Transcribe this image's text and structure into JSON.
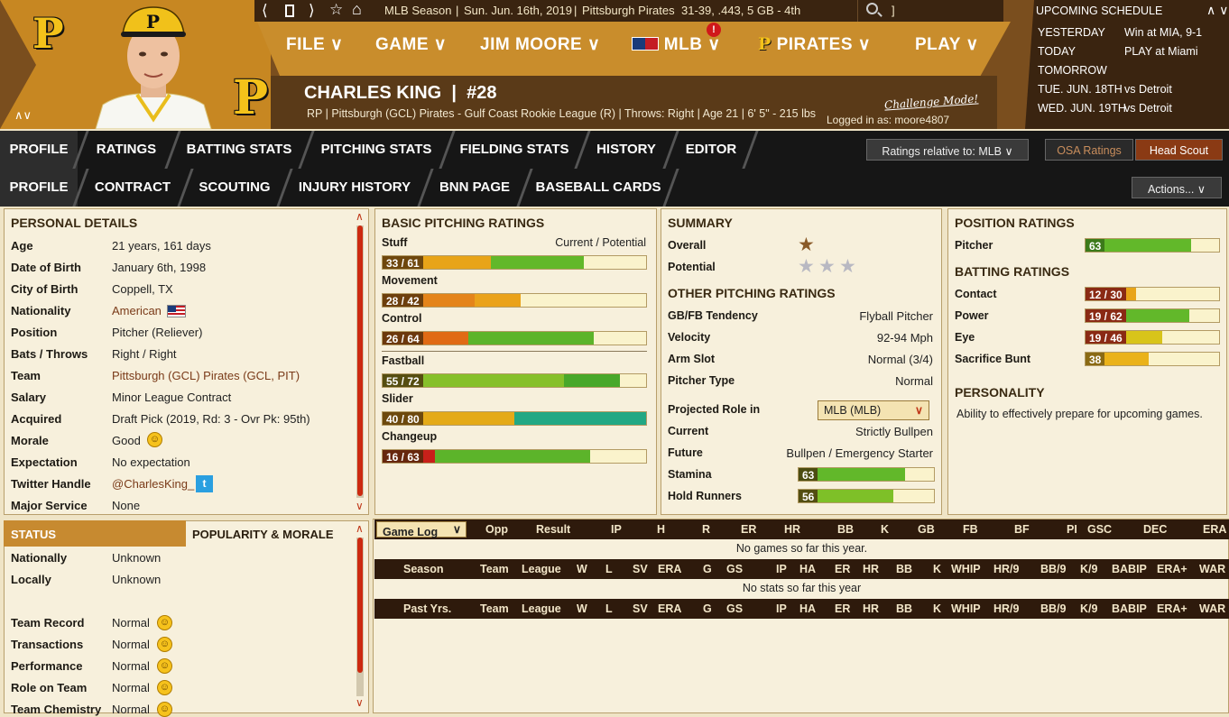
{
  "topbar": {
    "nav_icons": [
      "back-icon",
      "bookmark-icon",
      "forward-icon",
      "star-icon",
      "home-icon"
    ],
    "season_label": "MLB Season",
    "date": "Sun. Jun. 16th, 2019",
    "team": "Pittsburgh Pirates",
    "record": "31-39, .443, 5 GB - 4th",
    "search_label": "]"
  },
  "menu": {
    "items": [
      "FILE",
      "GAME",
      "JIM MOORE",
      "MLB",
      "PIRATES",
      "PLAY"
    ],
    "mlb_notification": "!"
  },
  "player": {
    "name": "CHARLES KING",
    "number": "#28",
    "info": "RP | Pittsburgh (GCL) Pirates - Gulf Coast Rookie League (R)  |  Throws: Right  |  Age 21  |  6' 5\" - 215 lbs",
    "challenge_mode": "Challenge Mode!",
    "logged_in": "Logged in as: moore4807",
    "collapse_label": "∧∨"
  },
  "schedule": {
    "title": "UPCOMING SCHEDULE",
    "toggle": "∧ ∨",
    "rows": [
      {
        "day": "YESTERDAY",
        "game": "Win at MIA, 9-1"
      },
      {
        "day": "TODAY",
        "game": "PLAY at Miami"
      },
      {
        "day": "TOMORROW",
        "game": ""
      },
      {
        "day": "TUE. JUN. 18TH",
        "game": "vs Detroit"
      },
      {
        "day": "WED. JUN. 19TH",
        "game": "vs Detroit"
      }
    ]
  },
  "tabs1": {
    "items": [
      "PROFILE",
      "RATINGS",
      "BATTING STATS",
      "PITCHING STATS",
      "FIELDING STATS",
      "HISTORY",
      "EDITOR"
    ],
    "ratings_relative": "Ratings relative to: MLB",
    "osa": "OSA Ratings",
    "head_scout": "Head Scout"
  },
  "tabs2": {
    "items": [
      "PROFILE",
      "CONTRACT",
      "SCOUTING",
      "INJURY HISTORY",
      "BNN PAGE",
      "BASEBALL CARDS"
    ],
    "actions": "Actions..."
  },
  "personal": {
    "title": "PERSONAL DETAILS",
    "rows": [
      {
        "label": "Age",
        "value": "21 years, 161 days"
      },
      {
        "label": "Date of Birth",
        "value": "January 6th, 1998"
      },
      {
        "label": "City of Birth",
        "value": "Coppell, TX"
      },
      {
        "label": "Nationality",
        "value": "American"
      },
      {
        "label": "Position",
        "value": "Pitcher (Reliever)"
      },
      {
        "label": "Bats / Throws",
        "value": "Right / Right"
      },
      {
        "label": "Team",
        "value": "Pittsburgh (GCL) Pirates (GCL, PIT)"
      },
      {
        "label": "Salary",
        "value": "Minor League Contract"
      },
      {
        "label": "Acquired",
        "value": "Draft Pick (2019, Rd: 3 - Ovr Pk: 95th)"
      },
      {
        "label": "Morale",
        "value": "Good"
      },
      {
        "label": "Expectation",
        "value": "No expectation"
      },
      {
        "label": "Twitter Handle",
        "value": "@CharlesKing_"
      },
      {
        "label": "Major Service",
        "value": "None"
      }
    ]
  },
  "status": {
    "tab_active": "STATUS",
    "tab_other": "POPULARITY & MORALE",
    "rows": [
      {
        "label": "Nationally",
        "value": "Unknown"
      },
      {
        "label": "Locally",
        "value": "Unknown"
      },
      {
        "label": "Team Record",
        "value": "Normal"
      },
      {
        "label": "Transactions",
        "value": "Normal"
      },
      {
        "label": "Performance",
        "value": "Normal"
      },
      {
        "label": "Role on Team",
        "value": "Normal"
      },
      {
        "label": "Team Chemistry",
        "value": "Normal"
      }
    ]
  },
  "basic_pitching": {
    "title": "BASIC PITCHING RATINGS",
    "col_header": "Current / Potential",
    "rows": [
      {
        "label": "Stuff",
        "text": "33 / 61",
        "cur": 33,
        "pot": 61,
        "cur_color": "#e8a418",
        "pot_color": "#62b82a"
      },
      {
        "label": "Movement",
        "text": "28 / 42",
        "cur": 28,
        "pot": 42,
        "cur_color": "#e4841a",
        "pot_color": "#eaa21a"
      },
      {
        "label": "Control",
        "text": "26 / 64",
        "cur": 26,
        "pot": 64,
        "cur_color": "#e06a14",
        "pot_color": "#5cb42a"
      },
      {
        "label": "Fastball",
        "text": "55 / 72",
        "cur": 55,
        "pot": 72,
        "cur_color": "#86c02a",
        "pot_color": "#48a82a"
      },
      {
        "label": "Slider",
        "text": "40 / 80",
        "cur": 40,
        "pot": 80,
        "cur_color": "#e4aa18",
        "pot_color": "#22a884"
      },
      {
        "label": "Changeup",
        "text": "16 / 63",
        "cur": 16,
        "pot": 63,
        "cur_color": "#c8201a",
        "pot_color": "#5cb42a"
      }
    ]
  },
  "summary": {
    "title": "SUMMARY",
    "overall_label": "Overall",
    "overall_stars": 0.5,
    "potential_label": "Potential",
    "potential_stars": 3
  },
  "other_pitching": {
    "title": "OTHER PITCHING RATINGS",
    "rows": [
      {
        "label": "GB/FB Tendency",
        "value": "Flyball Pitcher"
      },
      {
        "label": "Velocity",
        "value": "92-94 Mph"
      },
      {
        "label": "Arm Slot",
        "value": "Normal (3/4)"
      },
      {
        "label": "Pitcher Type",
        "value": "Normal"
      }
    ],
    "projected_label": "Projected Role in",
    "projected_select": "MLB (MLB)",
    "current_label": "Current",
    "current_value": "Strictly Bullpen",
    "future_label": "Future",
    "future_value": "Bullpen / Emergency Starter",
    "stamina_label": "Stamina",
    "stamina": 63,
    "hold_label": "Hold Runners",
    "hold": 56
  },
  "position_ratings": {
    "title": "POSITION RATINGS",
    "pitcher_label": "Pitcher",
    "pitcher_value": 63
  },
  "batting_ratings": {
    "title": "BATTING RATINGS",
    "rows": [
      {
        "label": "Contact",
        "text": "12 / 30",
        "cur": 12,
        "pot": 30,
        "badge_color": "#8a2a14",
        "pot_color": "#e8a418"
      },
      {
        "label": "Power",
        "text": "19 / 62",
        "cur": 19,
        "pot": 62,
        "badge_color": "#8a2a14",
        "pot_color": "#62b82a"
      },
      {
        "label": "Eye",
        "text": "19 / 46",
        "cur": 19,
        "pot": 46,
        "badge_color": "#8a2a14",
        "pot_color": "#d8c41a"
      },
      {
        "label": "Sacrifice Bunt",
        "text": "38",
        "cur": 38,
        "pot": 38,
        "badge_color": "#8a6a14",
        "pot_color": "#eab21a"
      }
    ]
  },
  "personality": {
    "title": "PERSONALITY",
    "text": "Ability to effectively prepare for upcoming games."
  },
  "gamelog": {
    "select": "Game Log",
    "headers": [
      "Opp",
      "Result",
      "IP",
      "H",
      "R",
      "ER",
      "HR",
      "BB",
      "K",
      "GB",
      "FB",
      "BF",
      "PI",
      "GSC",
      "DEC",
      "ERA"
    ],
    "empty": "No games so far this year."
  },
  "season_stats": {
    "headers": [
      "Season",
      "Team",
      "League",
      "W",
      "L",
      "SV",
      "ERA",
      "G",
      "GS",
      "IP",
      "HA",
      "ER",
      "HR",
      "BB",
      "K",
      "WHIP",
      "HR/9",
      "BB/9",
      "K/9",
      "BABIP",
      "ERA+",
      "WAR"
    ],
    "empty": "No stats so far this year"
  },
  "past_stats": {
    "headers": [
      "Past Yrs.",
      "Team",
      "League",
      "W",
      "L",
      "SV",
      "ERA",
      "G",
      "GS",
      "IP",
      "HA",
      "ER",
      "HR",
      "BB",
      "K",
      "WHIP",
      "HR/9",
      "BB/9",
      "K/9",
      "BABIP",
      "ERA+",
      "WAR"
    ]
  },
  "colors": {
    "header_gold": "#c98d2c",
    "header_brown": "#3a2410",
    "accent_red": "#cc2a10",
    "status_tab": "#c78a30"
  }
}
